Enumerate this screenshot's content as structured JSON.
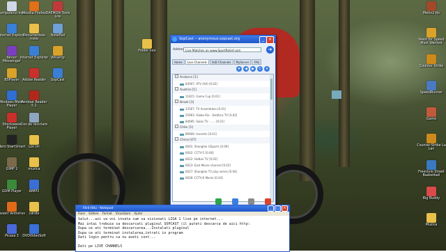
{
  "desktop": {
    "icons_left": [
      {
        "label": "Computerul meu",
        "color": "#cfd8e6"
      },
      {
        "label": "Internet Explorer",
        "color": "#3a7fd6"
      },
      {
        "label": "Yahoo! Messenger",
        "color": "#7a3fbf"
      },
      {
        "label": "BSPlayer",
        "color": "#d9a22a"
      },
      {
        "label": "Windows Media Player",
        "color": "#2f6fd1"
      },
      {
        "label": "Shockwave Player",
        "color": "#c9302c"
      },
      {
        "label": "Nero StartSmart",
        "color": "#222222"
      },
      {
        "label": "GIMP 2",
        "color": "#7a6a4a"
      },
      {
        "label": "GOM Player",
        "color": "#3a8a3a"
      },
      {
        "label": "avast! Antivirus",
        "color": "#e06a1a"
      },
      {
        "label": "Picasa 3",
        "color": "#4a6ad9"
      }
    ],
    "icons_col2": [
      {
        "label": "Mozilla Firefox",
        "color": "#e0701a"
      },
      {
        "label": "Documentele mele",
        "color": "#e8c04a"
      },
      {
        "label": "Internet Explorer",
        "color": "#3a7fd6"
      },
      {
        "label": "Adobe Reader",
        "color": "#c9302c"
      },
      {
        "label": "Acrobat Reader 5.1",
        "color": "#b0281c"
      },
      {
        "label": "Cos de reciclare",
        "color": "#8fa6c0"
      },
      {
        "label": "Loc ini",
        "color": "#e8c04a"
      },
      {
        "label": "muzica",
        "color": "#e8c04a"
      },
      {
        "label": "AIMP2",
        "color": "#3a6fd6"
      },
      {
        "label": "cdrille",
        "color": "#e8c04a"
      },
      {
        "label": "DVDVideoSoft",
        "color": "#3a6fd6"
      }
    ],
    "icons_col3": [
      {
        "label": "DAEMON Tools Lite",
        "color": "#c03a3a"
      },
      {
        "label": "NotePad",
        "color": "#6fa0d6"
      },
      {
        "label": "Winamp",
        "color": "#d9a22a"
      },
      {
        "label": "SopCast",
        "color": "#3a7fd6"
      }
    ],
    "folder": {
      "label": "Folder nou",
      "color": "#e8c04a"
    },
    "icons_right": [
      {
        "label": "Metin2 Ro",
        "color": "#a04a2a"
      },
      {
        "label": "Need for Speed Most Wanted",
        "color": "#d9a22a"
      },
      {
        "label": "Counter Strike",
        "color": "#cc8a1a"
      },
      {
        "label": "SpeedRunner",
        "color": "#4a7ac0"
      },
      {
        "label": "Game",
        "color": "#c05a3a"
      },
      {
        "label": "Counter-Strike La Lan",
        "color": "#cc8a1a"
      },
      {
        "label": "Freestyle Street Basketball",
        "color": "#3a7ac0"
      },
      {
        "label": "Big Buddy",
        "color": "#d94a4a"
      },
      {
        "label": "Muzica",
        "color": "#e8c04a"
      }
    ]
  },
  "sopcast": {
    "title": "SopCast -- anonymous.sopcast.org",
    "address_label": "Address",
    "address_value": "Live Matches on www.SportRelief.com",
    "tabs": [
      "Home",
      "Live Channels",
      "VoD Channels",
      "MyServer",
      "FAQ"
    ],
    "active_tab": "Live Channels",
    "groups": [
      {
        "name": "Andorra [1]",
        "channels": [
          "83907: ATV (A0) [0.02]"
        ]
      },
      {
        "name": "Austria [1]",
        "channels": [
          "11815: Game Cup [0.01]"
        ]
      },
      {
        "name": "Brazil [3]",
        "channels": [
          "23567: TV Assembleia [0.01]",
          "25963: Globo Rio - Estética TV [0.02]",
          "84695: Salas TV - ..... [0.01]"
        ]
      },
      {
        "name": "Chile [1]",
        "channels": [
          "89900: Inventin [0.01]"
        ]
      },
      {
        "name": "China [47]",
        "channels": [
          "6001: Shanghai GSports [0.09]",
          "6002: CCTV-5 [0.06]",
          "6022: HuNan TV [0.02]",
          "6023: East Movie channel [0.02]",
          "6027: Shanghai TV play series [0.04]",
          "6028: CCTV-6 Movie [0.04]"
        ]
      }
    ],
    "actions": [
      "Sub.",
      "Apply",
      "Option",
      "Logout"
    ]
  },
  "notepad": {
    "title": "Fără titlu - Notepad",
    "menu": [
      "Fișier",
      "Editare",
      "Format",
      "Vizualizare",
      "Ajutor"
    ],
    "text_lines": [
      "Salut...azi va voi invata cum sa vizionati LIGA 1 live pe internet...",
      "Mai intai trebuie sa descarcati pluginul SOPCAST (il puteti descarca de aici http:",
      "Dupa ce ati terminat descarcarea...Instalati pluginul",
      "Dupa ce ati terminat instalarea,intrati in program",
      "Dati login pentru ca nu aveti cont...",
      "",
      "Dati pe LIVE CHANNELS"
    ]
  }
}
